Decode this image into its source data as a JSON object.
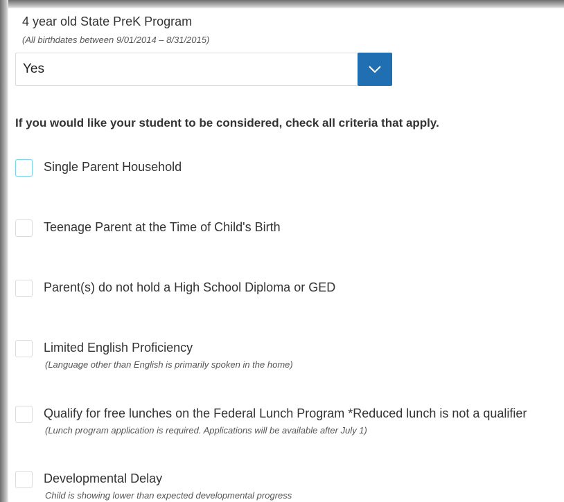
{
  "program": {
    "label": "4 year old State PreK Program",
    "hint": "(All birthdates between 9/01/2014 – 8/31/2015)",
    "select": {
      "value": "Yes",
      "button_icon": "chevron-down-icon",
      "button_color": "#1f6fb2"
    }
  },
  "criteria": {
    "intro": "If you would like your student to be considered, check all criteria that apply.",
    "options": [
      {
        "label": "Single Parent Household",
        "hint": "",
        "checked": false,
        "focused": true
      },
      {
        "label": "Teenage Parent at the Time of Child's Birth",
        "hint": "",
        "checked": false
      },
      {
        "label": "Parent(s) do not hold a High School Diploma or GED",
        "hint": "",
        "checked": false
      },
      {
        "label": "Limited English Proficiency",
        "hint": "(Language other than English is primarily spoken in the home)",
        "checked": false
      },
      {
        "label": "Qualify for free lunches on the Federal Lunch Program *Reduced lunch is not a qualifier",
        "hint": "(Lunch program application is required. Applications will be available after July 1)",
        "checked": false
      },
      {
        "label": "Developmental Delay",
        "hint": "Child is showing lower than expected developmental progress",
        "checked": false
      }
    ]
  }
}
